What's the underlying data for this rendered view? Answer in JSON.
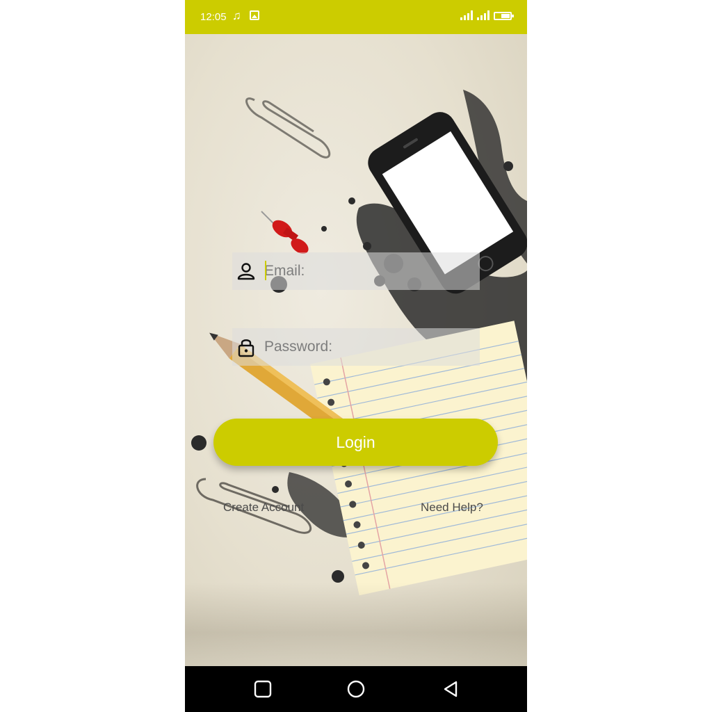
{
  "status_bar": {
    "time": "12:05",
    "music_icon": "music-note-icon",
    "image_icon": "image-icon",
    "background_color": "#cccc00"
  },
  "login_form": {
    "email_placeholder": "Email:",
    "email_icon": "user-icon",
    "password_placeholder": "Password:",
    "password_icon": "lock-icon",
    "login_label": "Login",
    "create_account_label": "Create Account",
    "need_help_label": "Need Help?",
    "accent_color": "#cccc00"
  },
  "nav_bar": {
    "recents_icon": "square-icon",
    "home_icon": "circle-icon",
    "back_icon": "triangle-back-icon"
  }
}
